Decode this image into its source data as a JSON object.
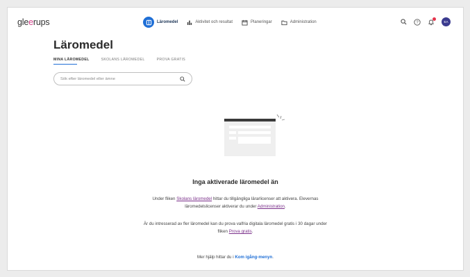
{
  "app": {
    "logo_prefix": "gle",
    "logo_accent": "e",
    "logo_suffix": "rups"
  },
  "nav": {
    "items": [
      {
        "label": "Läromedel",
        "icon": "book-icon",
        "active": true
      },
      {
        "label": "Aktivitet och resultat",
        "icon": "bar-chart-icon",
        "active": false
      },
      {
        "label": "Planeringar",
        "icon": "calendar-icon",
        "active": false
      },
      {
        "label": "Administration",
        "icon": "folder-icon",
        "active": false
      }
    ]
  },
  "toolbar": {
    "avatar_initials": "EA"
  },
  "page": {
    "title": "Läromedel",
    "tabs": [
      "MINA LÄROMEDEL",
      "SKOLANS LÄROMEDEL",
      "PROVA GRATIS"
    ],
    "active_tab": 0
  },
  "search": {
    "placeholder": "Sök efter läromedel eller ämne",
    "value": ""
  },
  "empty_state": {
    "title": "Inga aktiverade läromedel än",
    "p1_before": "Under fliken ",
    "p1_link1": "Skolans läromedel",
    "p1_middle": " hittar du tillgängliga lärarlicenser att aktivera. Elevernas",
    "p1_line2_before": "läromedelslicenser aktiverar du under ",
    "p1_link2": "Administration",
    "p1_end": ".",
    "p2_line1": "Är du intresserad av fler läromedel kan du prova valfria digitala läromedel gratis i 30 dagar under",
    "p2_line2_before": "fliken ",
    "p2_link": "Prova gratis",
    "p2_end": ".",
    "p3_before": "Mer hjälp hittar du i ",
    "p3_link": "Kom igång-menyn",
    "p3_end": "."
  },
  "colors": {
    "accent": "#1f6fd6",
    "brand_pink": "#d2458b",
    "link": "#7a2f8a",
    "notification": "#e5334b"
  }
}
